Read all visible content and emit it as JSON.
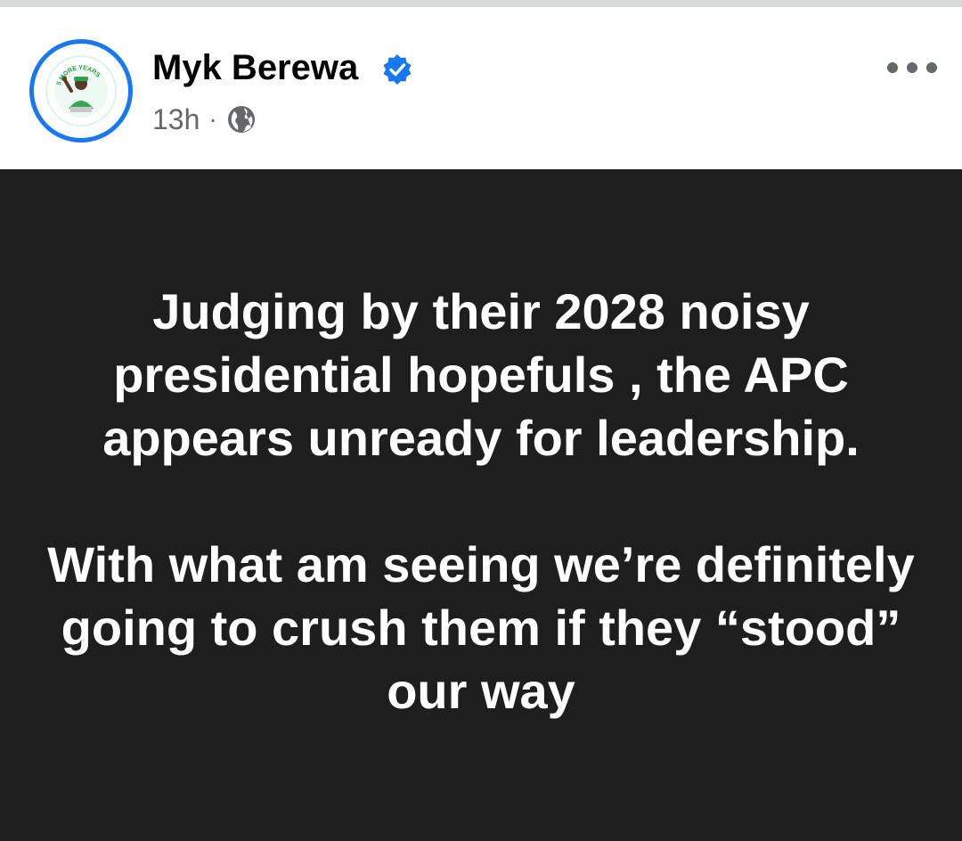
{
  "post": {
    "author": {
      "name": "Myk Berewa",
      "verified": true,
      "avatar_text": "5 MORE YEARS",
      "avatar_icon": "profile-photo"
    },
    "timestamp": "13h",
    "separator": "·",
    "audience_icon": "globe-icon",
    "more_icon": "more-options-icon",
    "background_color": "#1e1e1e",
    "text_color": "#ffffff",
    "text_paragraphs": [
      "Judging by their 2028 noisy presidential hopefuls , the APC appears unready for leadership.",
      "With what am seeing we’re definitely going to crush them if they “stood” our way"
    ]
  },
  "colors": {
    "accent": "#1877f2",
    "meta_text": "#65676b",
    "name_text": "#050505"
  }
}
